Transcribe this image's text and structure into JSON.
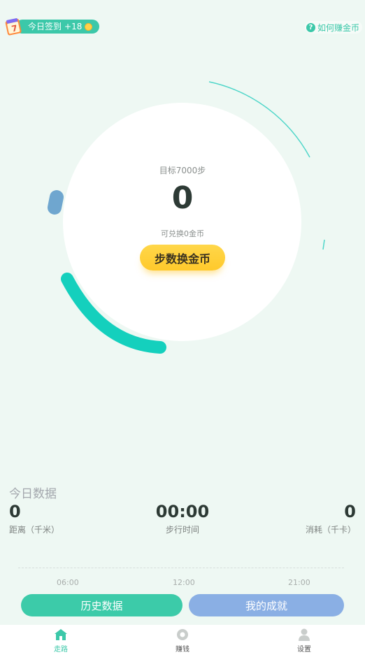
{
  "header": {
    "checkin_label": "今日签到",
    "checkin_bonus": "+18",
    "how_to_earn": "如何赚金币"
  },
  "main": {
    "goal_text": "目标7000步",
    "steps": "0",
    "exchangeable_text": "可兑换0金币",
    "convert_button": "步数换金币"
  },
  "today": {
    "title": "今日数据",
    "distance_value": "0",
    "distance_label": "距离（千米）",
    "time_value": "00:00",
    "time_label": "步行时间",
    "calorie_value": "0",
    "calorie_label": "消耗（千卡）"
  },
  "timeline": {
    "ticks": [
      "06:00",
      "12:00",
      "21:00"
    ]
  },
  "actions": {
    "history": "历史数据",
    "achievements": "我的成就"
  },
  "nav": {
    "items": [
      {
        "label": "走路",
        "icon": "walk-home-icon",
        "active": true
      },
      {
        "label": "赚钱",
        "icon": "earn-coin-icon",
        "active": false
      },
      {
        "label": "设置",
        "icon": "profile-icon",
        "active": false
      }
    ]
  },
  "colors": {
    "accent": "#3cc8a9",
    "background": "#eef8f3",
    "button_yellow": "#ffd24a",
    "achieve_blue": "#8aafe4"
  }
}
